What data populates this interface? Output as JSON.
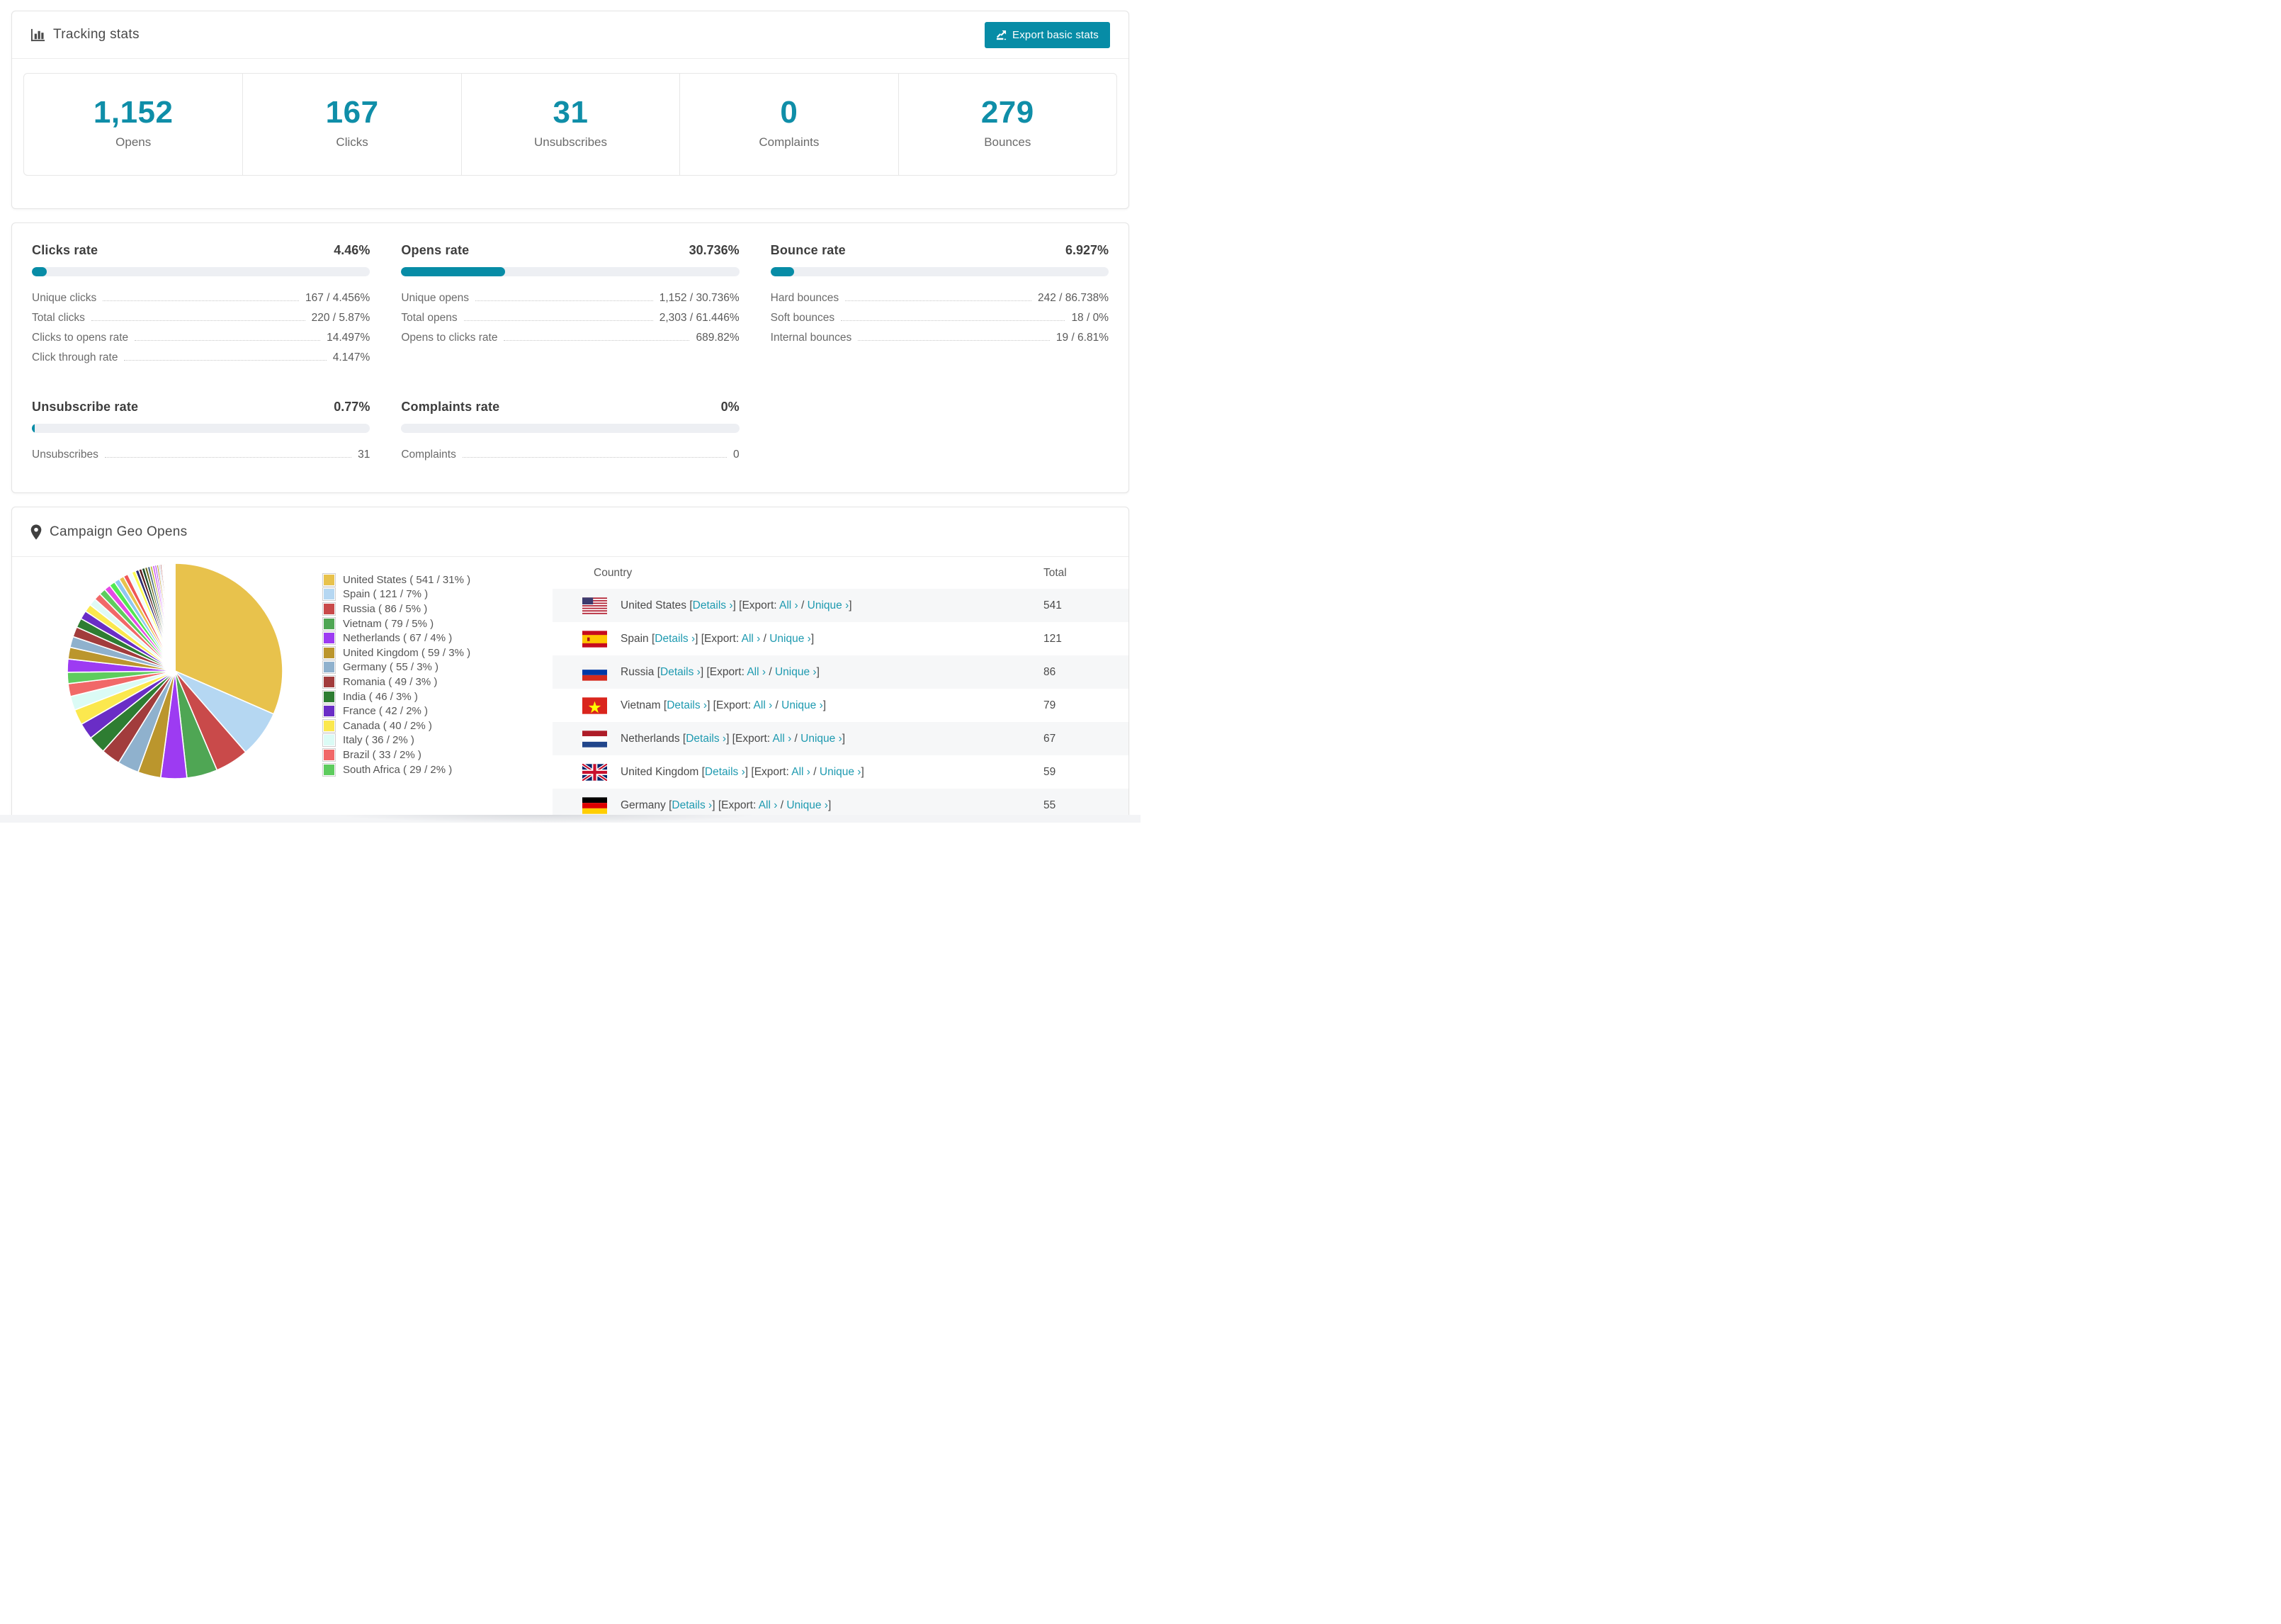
{
  "accent": "#078ca6",
  "header": {
    "title": "Tracking stats",
    "export_label": "Export basic stats"
  },
  "summary": [
    {
      "value": "1,152",
      "label": "Opens"
    },
    {
      "value": "167",
      "label": "Clicks"
    },
    {
      "value": "31",
      "label": "Unsubscribes"
    },
    {
      "value": "0",
      "label": "Complaints"
    },
    {
      "value": "279",
      "label": "Bounces"
    }
  ],
  "rates": [
    {
      "title": "Clicks rate",
      "value": "4.46%",
      "pct": 4.46,
      "rows": [
        {
          "label": "Unique clicks",
          "value": "167 / 4.456%"
        },
        {
          "label": "Total clicks",
          "value": "220 / 5.87%"
        },
        {
          "label": "Clicks to opens rate",
          "value": "14.497%"
        },
        {
          "label": "Click through rate",
          "value": "4.147%"
        }
      ]
    },
    {
      "title": "Opens rate",
      "value": "30.736%",
      "pct": 30.736,
      "rows": [
        {
          "label": "Unique opens",
          "value": "1,152 / 30.736%"
        },
        {
          "label": "Total opens",
          "value": "2,303 / 61.446%"
        },
        {
          "label": "Opens to clicks rate",
          "value": "689.82%"
        }
      ]
    },
    {
      "title": "Bounce rate",
      "value": "6.927%",
      "pct": 6.927,
      "rows": [
        {
          "label": "Hard bounces",
          "value": "242 / 86.738%"
        },
        {
          "label": "Soft bounces",
          "value": "18 / 0%"
        },
        {
          "label": "Internal bounces",
          "value": "19 / 6.81%"
        }
      ]
    },
    {
      "title": "Unsubscribe rate",
      "value": "0.77%",
      "pct": 0.77,
      "rows": [
        {
          "label": "Unsubscribes",
          "value": "31"
        }
      ]
    },
    {
      "title": "Complaints rate",
      "value": "0%",
      "pct": 0,
      "rows": [
        {
          "label": "Complaints",
          "value": "0"
        }
      ]
    }
  ],
  "geo": {
    "title": "Campaign Geo Opens",
    "table_headers": {
      "country": "Country",
      "total": "Total"
    },
    "link_labels": {
      "details": "Details",
      "export": "Export:",
      "all": "All",
      "unique": "Unique",
      "chevron": "›"
    },
    "rows": [
      {
        "country": "United States",
        "flag": "us",
        "total": "541"
      },
      {
        "country": "Spain",
        "flag": "es",
        "total": "121"
      },
      {
        "country": "Russia",
        "flag": "ru",
        "total": "86"
      },
      {
        "country": "Vietnam",
        "flag": "vn",
        "total": "79"
      },
      {
        "country": "Netherlands",
        "flag": "nl",
        "total": "67"
      },
      {
        "country": "United Kingdom",
        "flag": "gb",
        "total": "59"
      },
      {
        "country": "Germany",
        "flag": "de",
        "total": "55"
      }
    ]
  },
  "chart_data": {
    "type": "pie",
    "title": "Campaign Geo Opens",
    "legend_position": "right",
    "start_angle_deg": 0,
    "direction": "clockwise",
    "countries": [
      {
        "name": "United States",
        "value": 541,
        "pct": 31,
        "color": "#e8c24c"
      },
      {
        "name": "Spain",
        "value": 121,
        "pct": 7,
        "color": "#b5d7f2"
      },
      {
        "name": "Russia",
        "value": 86,
        "pct": 5,
        "color": "#c94a4a"
      },
      {
        "name": "Vietnam",
        "value": 79,
        "pct": 5,
        "color": "#4fa654"
      },
      {
        "name": "Netherlands",
        "value": 67,
        "pct": 4,
        "color": "#9d3bf2"
      },
      {
        "name": "United Kingdom",
        "value": 59,
        "pct": 3,
        "color": "#bb962d"
      },
      {
        "name": "Germany",
        "value": 55,
        "pct": 3,
        "color": "#8fb1cd"
      },
      {
        "name": "Romania",
        "value": 49,
        "pct": 3,
        "color": "#a23c3c"
      },
      {
        "name": "India",
        "value": 46,
        "pct": 3,
        "color": "#2e7d32"
      },
      {
        "name": "France",
        "value": 42,
        "pct": 2,
        "color": "#6a2dc6"
      },
      {
        "name": "Canada",
        "value": 40,
        "pct": 2,
        "color": "#fbe84e"
      },
      {
        "name": "Italy",
        "value": 36,
        "pct": 2,
        "color": "#dbfbf5"
      },
      {
        "name": "Brazil",
        "value": 33,
        "pct": 2,
        "color": "#f16868"
      },
      {
        "name": "South Africa",
        "value": 29,
        "pct": 2,
        "color": "#5ecc5e"
      }
    ],
    "legend_value_format": "( value / pct% )",
    "other_slice_values": [
      34,
      30,
      28,
      26,
      24,
      22,
      20,
      19,
      18,
      17,
      16,
      15,
      14,
      13,
      12,
      11,
      10,
      9,
      8,
      8,
      7,
      7,
      6,
      6,
      5,
      5,
      4,
      4,
      3,
      3,
      3,
      2,
      2,
      2,
      2,
      2,
      1,
      1,
      1,
      1,
      1,
      1,
      1,
      1,
      1,
      1,
      1,
      1,
      1,
      1,
      1
    ],
    "other_slice_palette": [
      "#9d3bf2",
      "#bb962d",
      "#8fb1cd",
      "#a23c3c",
      "#2e7d32",
      "#6a2dc6",
      "#fbe84e",
      "#dffaf5",
      "#f16868",
      "#5ecc5e",
      "#e44ae5",
      "#52e852",
      "#8fc7f0",
      "#e8c24c",
      "#f05555",
      "#eefcff",
      "#fcfc55",
      "#2c2c6e",
      "#5c1f1f",
      "#1e4e28",
      "#6e6e1e",
      "#4a6a86",
      "#b8b82e",
      "#d055f0"
    ]
  }
}
